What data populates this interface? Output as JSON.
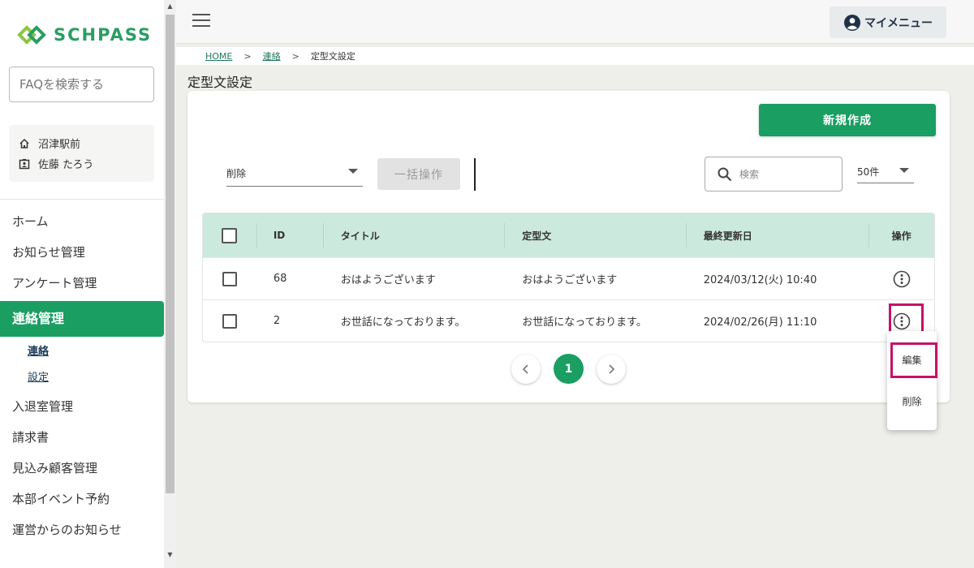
{
  "brand": {
    "name": "SCHPASS",
    "color": "#2a9d63"
  },
  "sidebar": {
    "faq_placeholder": "FAQを検索する",
    "school": "沼津駅前",
    "user": "佐藤 たろう",
    "items": [
      {
        "label": "ホーム"
      },
      {
        "label": "お知らせ管理"
      },
      {
        "label": "アンケート管理"
      },
      {
        "label": "連絡管理",
        "active": true
      },
      {
        "label": "入退室管理"
      },
      {
        "label": "請求書"
      },
      {
        "label": "見込み顧客管理"
      },
      {
        "label": "本部イベント予約"
      },
      {
        "label": "運営からのお知らせ"
      }
    ],
    "subitems": [
      {
        "label": "連絡",
        "current": true
      },
      {
        "label": "設定"
      }
    ]
  },
  "header": {
    "mymenu_label": "マイメニュー"
  },
  "breadcrumb": {
    "home": "HOME",
    "sep": ">",
    "parent": "連絡",
    "current": "定型文設定"
  },
  "page": {
    "title": "定型文設定"
  },
  "toolbar": {
    "new_label": "新規作成",
    "bulk_selected": "削除",
    "bulk_button": "一括操作",
    "search_placeholder": "検索",
    "per_page": "50件"
  },
  "table": {
    "headers": {
      "id": "ID",
      "title": "タイトル",
      "body": "定型文",
      "updated": "最終更新日",
      "ops": "操作"
    },
    "rows": [
      {
        "id": "68",
        "title": "おはようございます",
        "body": "おはようございます",
        "updated": "2024/03/12(火) 10:40"
      },
      {
        "id": "2",
        "title": "お世話になっております。",
        "body": "お世話になっております。",
        "updated": "2024/02/26(月) 11:10"
      }
    ]
  },
  "pagination": {
    "current": "1"
  },
  "popup_menu": {
    "edit": "編集",
    "delete": "削除"
  },
  "colors": {
    "accent": "#1a9e62",
    "table_header": "#cce9de",
    "highlight": "#c41268"
  }
}
